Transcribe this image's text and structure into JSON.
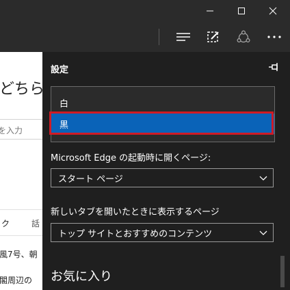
{
  "page_fragments": {
    "heading": "どちら",
    "search_hint": "を入力",
    "tab_1": "ク",
    "tab_2": "話",
    "news_1": "風7号、朝",
    "news_2": "閣周辺の"
  },
  "settings": {
    "title": "設定",
    "theme_options": [
      "白",
      "黒"
    ],
    "selected_theme": "黒",
    "startup_label": "Microsoft Edge の起動時に開くページ:",
    "startup_value": "スタート ページ",
    "newtab_label": "新しいタブを開いたときに表示するページ",
    "newtab_value": "トップ サイトとおすすめのコンテンツ",
    "favorites_heading": "お気に入り"
  },
  "icons": {
    "minimize": "minimize-icon",
    "maximize": "maximize-icon",
    "close": "close-icon",
    "hub": "hub-icon",
    "web_note": "web-note-icon",
    "share": "share-icon",
    "more": "more-icon",
    "pin": "pin-icon"
  },
  "colors": {
    "chrome_bg": "#2b2b2b",
    "panel_bg": "#1f1f1f",
    "selected_option": "#0a63b8",
    "highlight_box": "#d01b25"
  }
}
